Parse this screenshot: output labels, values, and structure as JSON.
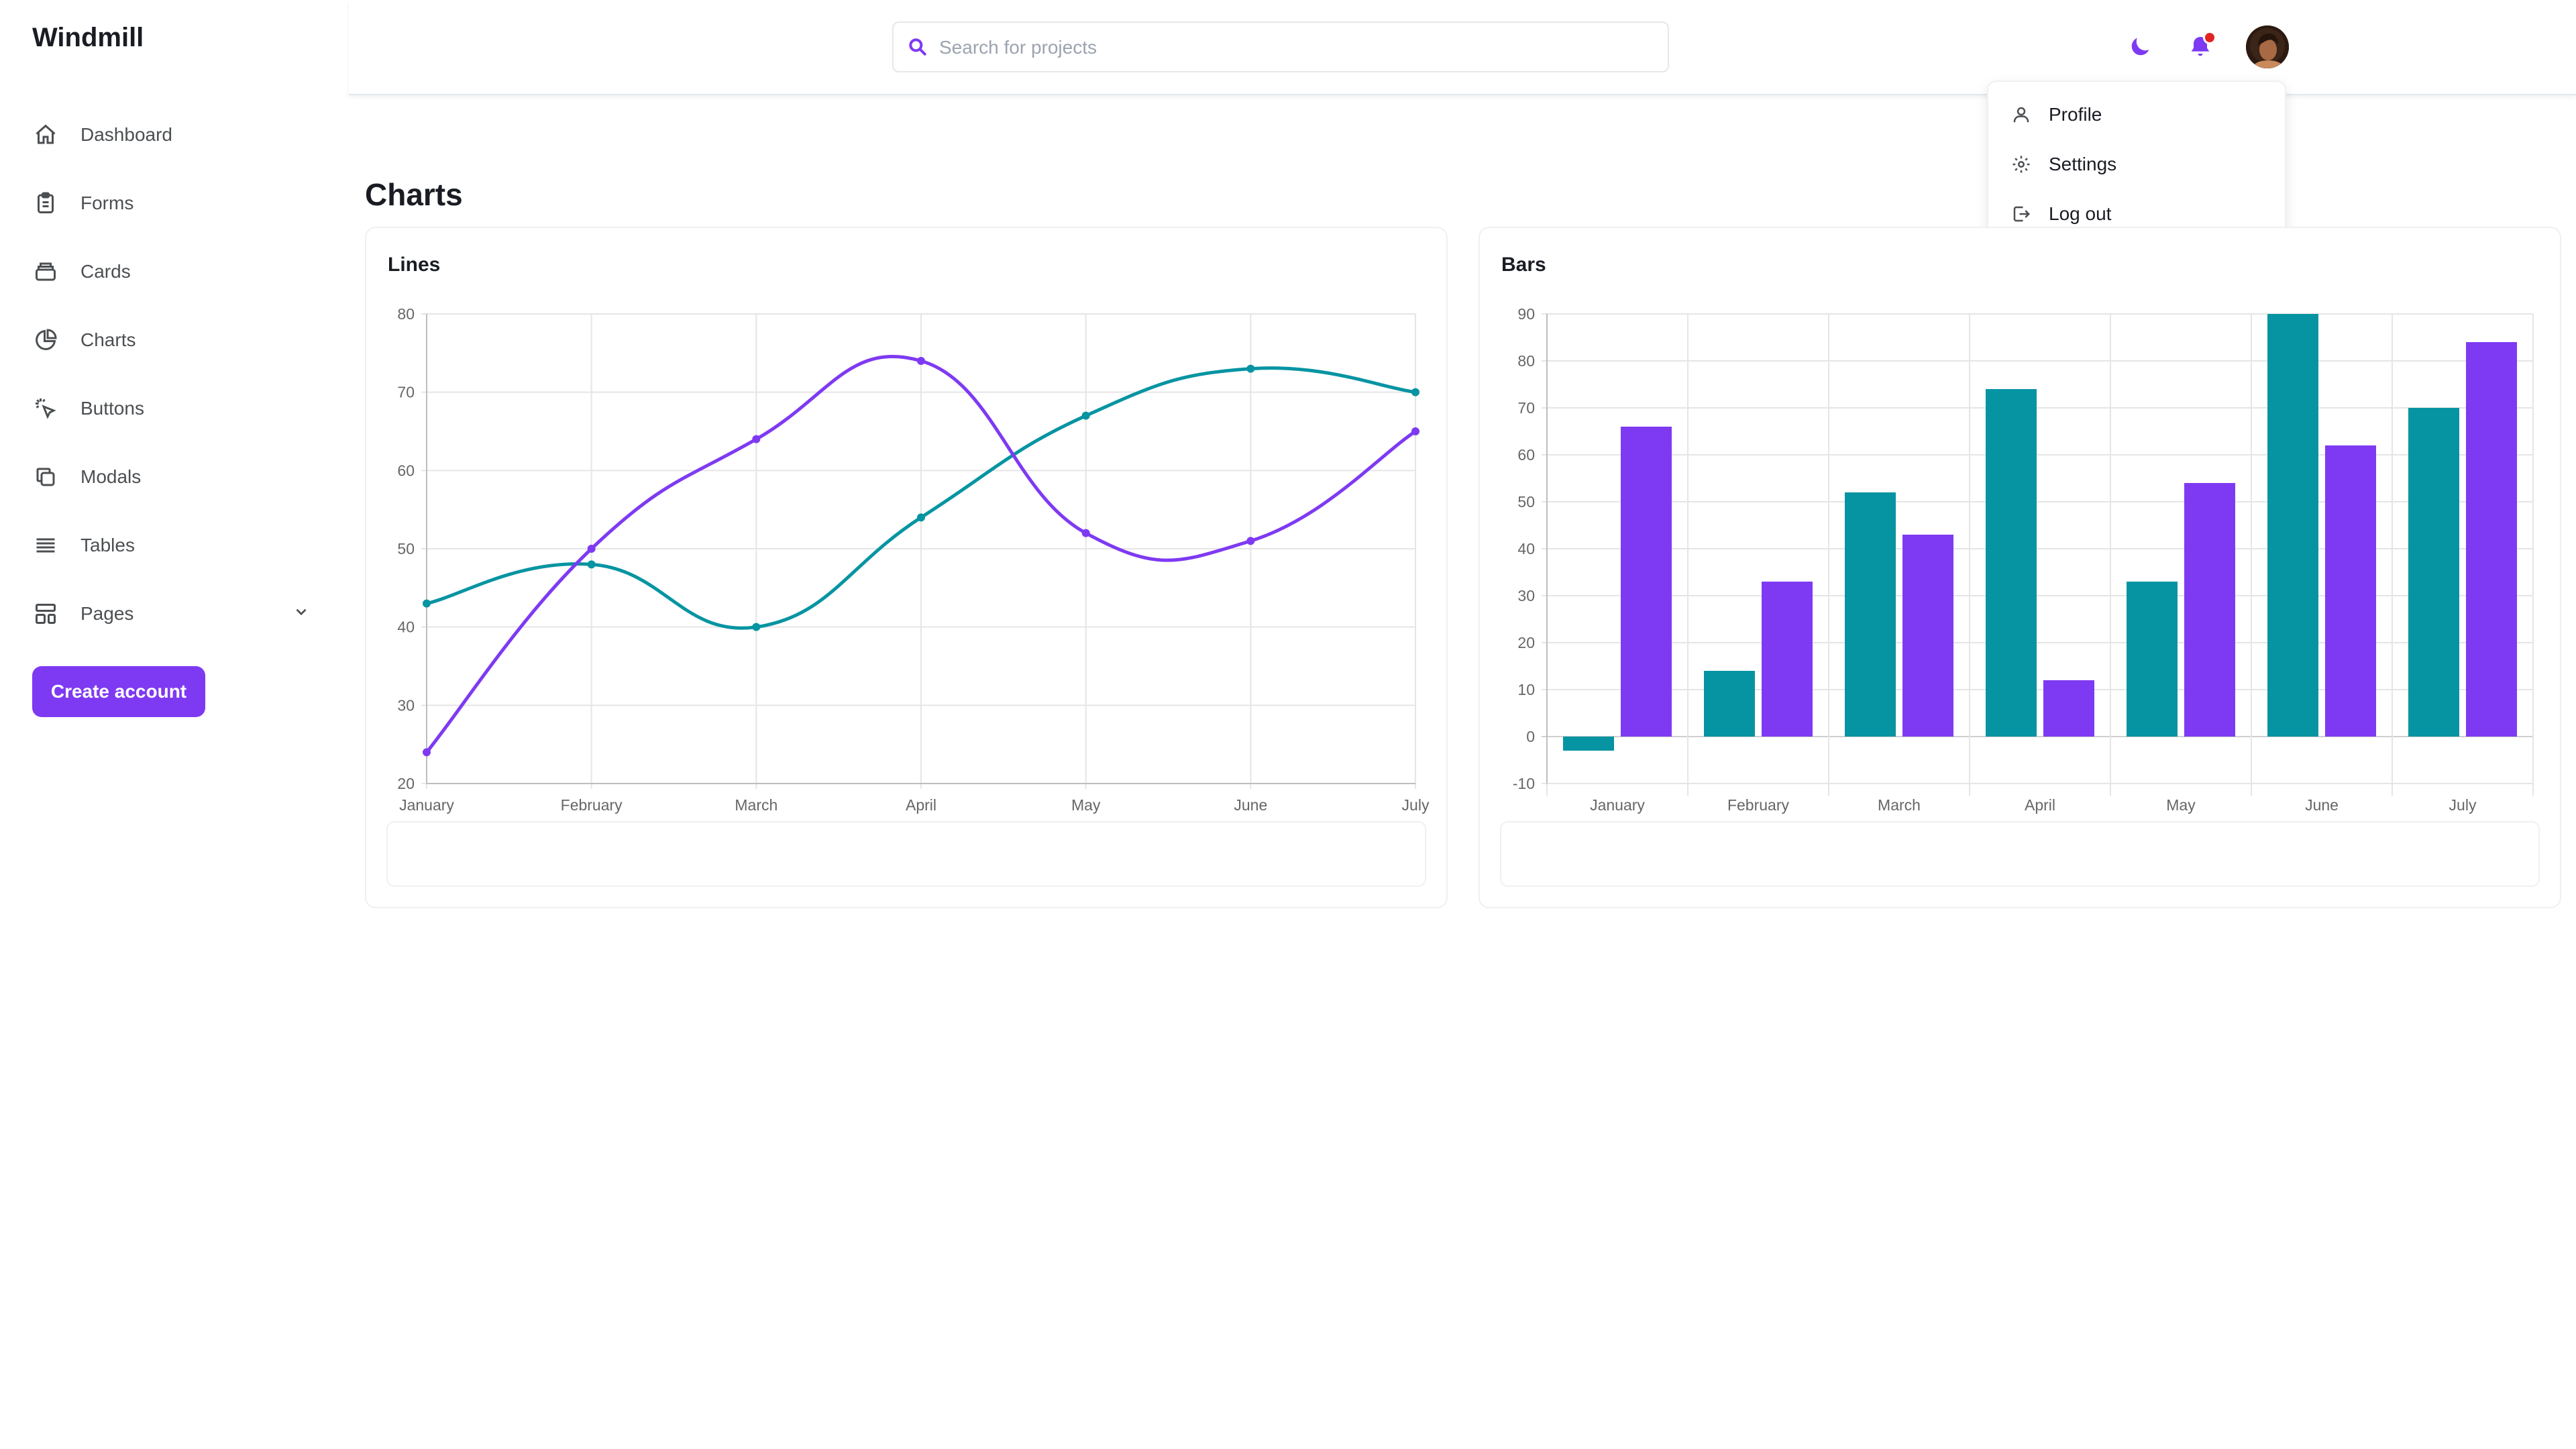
{
  "app": {
    "title": "Windmill"
  },
  "sidebar": {
    "items": [
      {
        "label": "Dashboard",
        "icon": "home-icon"
      },
      {
        "label": "Forms",
        "icon": "clipboard-icon"
      },
      {
        "label": "Cards",
        "icon": "cards-icon"
      },
      {
        "label": "Charts",
        "icon": "pie-chart-icon"
      },
      {
        "label": "Buttons",
        "icon": "cursor-click-icon"
      },
      {
        "label": "Modals",
        "icon": "modals-icon"
      },
      {
        "label": "Tables",
        "icon": "menu-lines-icon"
      },
      {
        "label": "Pages",
        "icon": "template-icon"
      }
    ],
    "create_account": "Create account"
  },
  "header": {
    "search_placeholder": "Search for projects",
    "search_value": ""
  },
  "profile_menu": {
    "items": [
      {
        "label": "Profile",
        "icon": "user-icon"
      },
      {
        "label": "Settings",
        "icon": "gear-icon"
      },
      {
        "label": "Log out",
        "icon": "logout-icon"
      }
    ]
  },
  "main": {
    "page_title": "Charts"
  },
  "colors": {
    "accent": "#7e3af2",
    "teal": "#0694a2",
    "notification": "#e02424"
  },
  "chart_data": [
    {
      "type": "line",
      "title": "Lines",
      "categories": [
        "January",
        "February",
        "March",
        "April",
        "May",
        "June",
        "July"
      ],
      "series": [
        {
          "color": "#0694a2",
          "values": [
            43,
            48,
            40,
            54,
            67,
            73,
            70
          ]
        },
        {
          "color": "#7e3af2",
          "values": [
            24,
            50,
            64,
            74,
            52,
            51,
            65
          ]
        }
      ],
      "ylim": [
        20,
        80
      ],
      "yticks": [
        20,
        30,
        40,
        50,
        60,
        70,
        80
      ],
      "grid": true
    },
    {
      "type": "bar",
      "title": "Bars",
      "categories": [
        "January",
        "February",
        "March",
        "April",
        "May",
        "June",
        "July"
      ],
      "series": [
        {
          "color": "#0694a2",
          "values": [
            -3,
            14,
            52,
            74,
            33,
            90,
            70
          ]
        },
        {
          "color": "#7e3af2",
          "values": [
            66,
            33,
            43,
            12,
            54,
            62,
            84
          ]
        }
      ],
      "ylim": [
        -10,
        90
      ],
      "yticks": [
        -10,
        0,
        10,
        20,
        30,
        40,
        50,
        60,
        70,
        80,
        90
      ],
      "grid": true
    }
  ]
}
